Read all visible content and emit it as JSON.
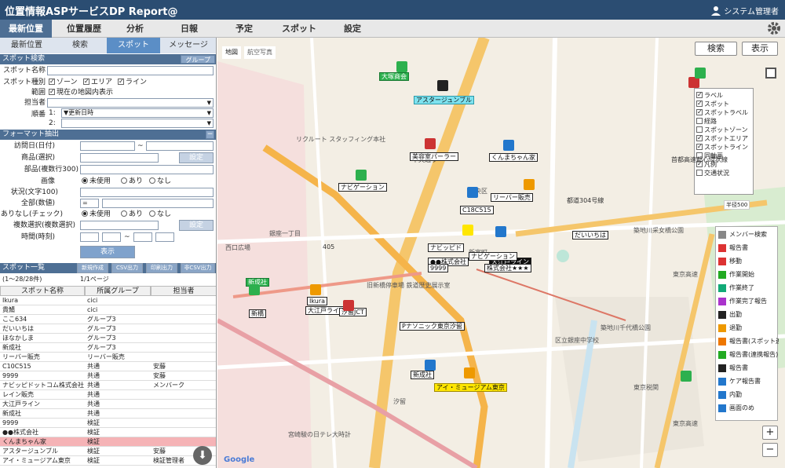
{
  "app": {
    "title": "位置情報ASPサービスDP Report@",
    "user": "システム管理者"
  },
  "nav": [
    "最新位置",
    "位置履歴",
    "分析",
    "日報",
    "予定",
    "スポット",
    "設定"
  ],
  "sidebar": {
    "tabs": [
      "最新位置",
      "検索",
      "スポット",
      "メッセージ"
    ],
    "spot_search": {
      "header": "スポット検索",
      "group_btn": "グループ",
      "name_label": "スポット名称",
      "type_label": "スポット種別",
      "types": [
        "ゾーン",
        "エリア",
        "ライン"
      ],
      "range_label": "範囲",
      "range_option": "現在の地図内表示",
      "owner_label": "担当者",
      "order_label": "順番",
      "order1_num": "1:",
      "order1_val": "▼更新日時",
      "order2_num": "2:"
    },
    "format": {
      "header": "フォーマット抽出",
      "visit_label": "訪問日(日付)",
      "tilde": "~",
      "product_label": "商品(選択)",
      "settings_btn": "設定",
      "parts_label": "部品(複数行300)",
      "image_label": "画像",
      "r_unused": "未使用",
      "r_yes": "あり",
      "r_no": "なし",
      "status_label": "状況(文字100)",
      "all_label": "全部(数値)",
      "all_op": "=",
      "check_label": "ありなし(チェック)",
      "multi_label": "複数選択(複数選択)",
      "time_label": "時間(時刻)",
      "show_btn": "表示"
    },
    "list": {
      "header": "スポット一覧",
      "buttons": [
        "新規作成",
        "CSV出力",
        "印刷出力",
        "非CSV出力"
      ],
      "count": "(1〜28/28件)",
      "page": "1/1ページ",
      "cols": [
        "スポット名称",
        "所属グループ",
        "担当者"
      ],
      "rows": [
        [
          "Ikura",
          "cici",
          ""
        ],
        [
          "貴鯖",
          "cici",
          ""
        ],
        [
          "ここ634",
          "グループ3",
          ""
        ],
        [
          "だいいちは",
          "グループ3",
          ""
        ],
        [
          "ほなかしま",
          "グループ3",
          ""
        ],
        [
          "新成社",
          "グループ3",
          ""
        ],
        [
          "リーバー販売",
          "リーバー販売",
          ""
        ],
        [
          "C10C515",
          "共通",
          "安藤"
        ],
        [
          "9999",
          "共通",
          "安藤"
        ],
        [
          "ナビッピドットコム株式会社",
          "共通",
          "メンバーク"
        ],
        [
          "レイン販売",
          "共通",
          ""
        ],
        [
          "大江戸ライン",
          "共通",
          ""
        ],
        [
          "新成社",
          "共通",
          ""
        ],
        [
          "9999",
          "検証",
          ""
        ],
        [
          "●●株式会社",
          "検証",
          ""
        ],
        [
          "くんまちゃん家",
          "検証",
          ""
        ],
        [
          "アスタージュンブル",
          "検証",
          "安藤"
        ],
        [
          "アイ・ミュージアム東京",
          "検証",
          "検証管理者"
        ]
      ]
    }
  },
  "map": {
    "type_map": "地図",
    "type_photo": "航空写真",
    "search_btn": "検索",
    "show_btn": "表示",
    "layers": [
      "ラベル",
      "スポット",
      "スポットラベル",
      "経路",
      "スポットゾーン",
      "スポットエリア",
      "スポットライン",
      "同軸画",
      "凡例",
      "交通状況"
    ],
    "radius_label": "半径500",
    "legend": [
      {
        "label": "メンバー検索",
        "color": "#888"
      },
      {
        "label": "報告書",
        "color": "#d33"
      },
      {
        "label": "移動",
        "color": "#d33"
      },
      {
        "label": "作業開始",
        "color": "#2a2"
      },
      {
        "label": "作業終了",
        "color": "#1a7"
      },
      {
        "label": "作業完了報告",
        "color": "#a3c"
      },
      {
        "label": "出勤",
        "color": "#222"
      },
      {
        "label": "退勤",
        "color": "#e90"
      },
      {
        "label": "報告書(スポット連携)",
        "color": "#e70"
      },
      {
        "label": "報告書(連携報告)",
        "color": "#2a2"
      },
      {
        "label": "報告書",
        "color": "#222"
      },
      {
        "label": "ケア報告書",
        "color": "#27c"
      },
      {
        "label": "内勤",
        "color": "#27c"
      },
      {
        "label": "画面のめ",
        "color": "#27c"
      }
    ],
    "areas": [
      "銀座一丁目",
      "新富町",
      "中央区",
      "築地川采女橋公園",
      "築地川千代橋公園",
      "区立銀座中学校",
      "東京高速",
      "旧新橋停車場 鉄道歴史展示室",
      "宮崎駿の日テレ大時計",
      "東京税関",
      "リクルート スタッフィング本社",
      "汐留",
      "西口広場",
      "東京高速"
    ],
    "roads": [
      "405",
      "中央通り",
      "都道304号線",
      "首都高速都心環状線"
    ],
    "zoom_in": "+",
    "zoom_out": "−",
    "pins": [
      "大塚商会",
      "アスタージュンブル",
      "美容室パーラー",
      "くんまちゃん家",
      "C18C515",
      "リーバー販売",
      "だいいちは",
      "大江戸ライン",
      "株式会社★★★",
      "ナビッピド",
      "●●株式会社",
      "9999",
      "Ikura",
      "大江戸ライン",
      "ナビゲーション",
      "Pナソニック東京汐留",
      "新成社",
      "アイ・ミュージアム東京",
      "新成社",
      "汐留JCT",
      "新橋",
      "ナビゲーション"
    ]
  }
}
